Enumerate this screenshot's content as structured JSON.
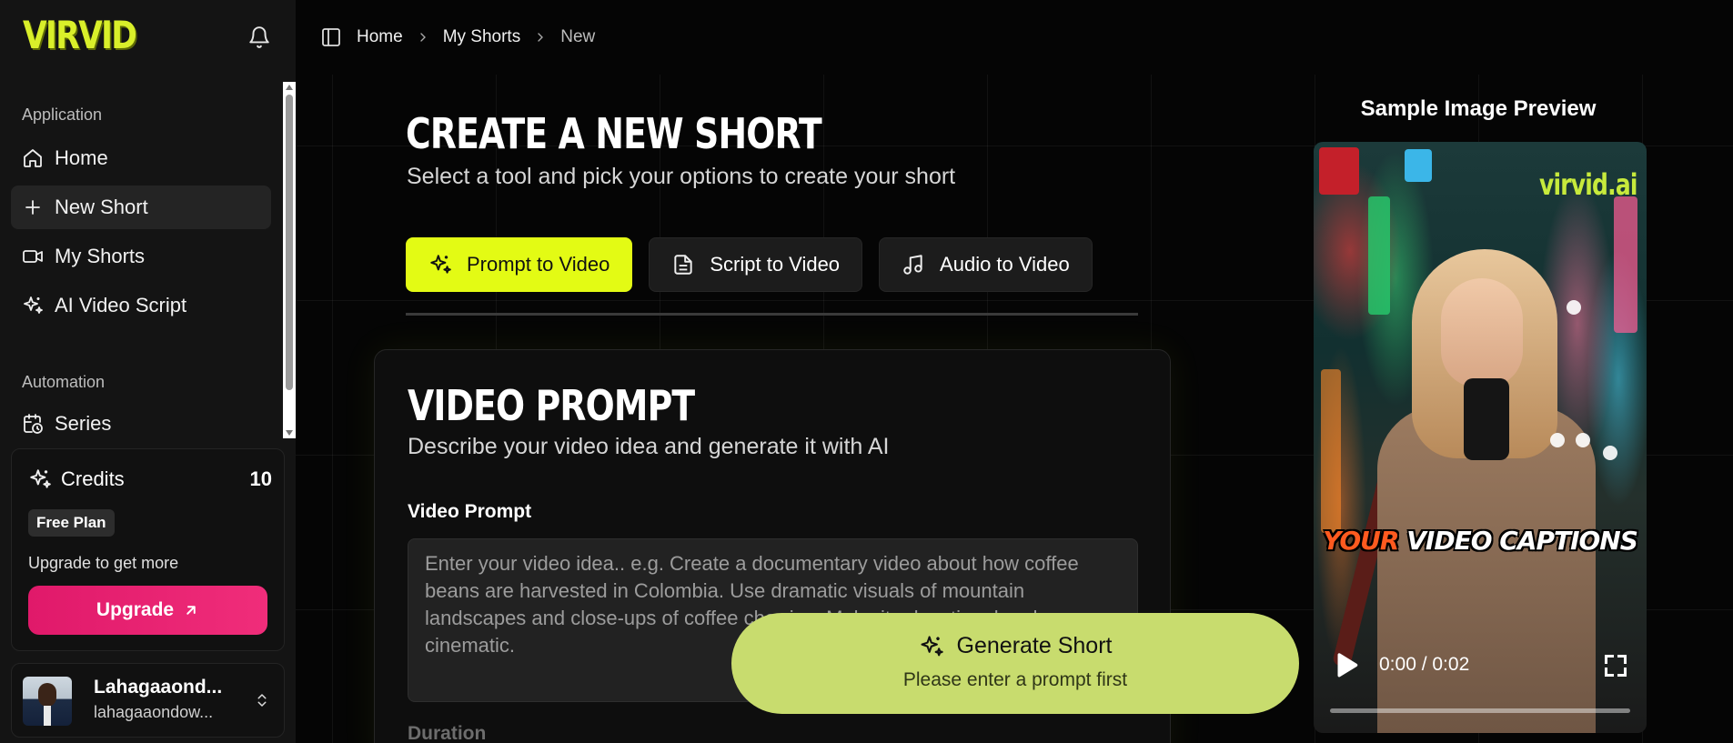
{
  "app": {
    "logo_text": "VIRVID"
  },
  "sidebar": {
    "sections": [
      {
        "title": "Application"
      },
      {
        "title": "Automation"
      }
    ],
    "items": [
      {
        "label": "Home",
        "icon": "home-icon"
      },
      {
        "label": "New Short",
        "icon": "plus-icon",
        "active": true
      },
      {
        "label": "My Shorts",
        "icon": "video-icon"
      },
      {
        "label": "AI Video Script",
        "icon": "sparkles-icon"
      },
      {
        "label": "Series",
        "icon": "calendar-clock-icon"
      }
    ],
    "credits": {
      "label": "Credits",
      "count": "10",
      "plan": "Free Plan",
      "upgrade_text": "Upgrade to get more",
      "upgrade_button": "Upgrade"
    },
    "user": {
      "name": "Lahagaaond...",
      "email": "lahagaaondow..."
    }
  },
  "breadcrumb": [
    "Home",
    "My Shorts",
    "New"
  ],
  "page": {
    "title": "CREATE A NEW SHORT",
    "subtitle": "Select a tool and pick your options to create your short"
  },
  "tabs": [
    {
      "label": "Prompt to Video",
      "icon": "sparkles-icon",
      "active": true
    },
    {
      "label": "Script to Video",
      "icon": "document-icon"
    },
    {
      "label": "Audio to Video",
      "icon": "music-note-icon"
    }
  ],
  "prompt_card": {
    "title": "VIDEO PROMPT",
    "subtitle": "Describe your video idea and generate it with AI",
    "field_label": "Video Prompt",
    "placeholder": "Enter your video idea.. e.g. Create a documentary video about how coffee beans are harvested in Colombia. Use dramatic visuals of mountain landscapes and close-ups of coffee cherries. Make it educational and cinematic.",
    "value": "",
    "duration_label": "Duration"
  },
  "generate": {
    "label": "Generate Short",
    "hint": "Please enter a prompt first"
  },
  "preview": {
    "title": "Sample Image Preview",
    "watermark": "virvid.ai",
    "caption_highlight": "YOUR",
    "caption_rest": " VIDEO CAPTIONS",
    "time": "0:00 / 0:02",
    "progress": 0
  },
  "colors": {
    "accent": "#e3fb14",
    "upgrade": "#e81d70",
    "generate_button": "#c8dc6e",
    "caption_highlight": "#ff5a1f"
  }
}
